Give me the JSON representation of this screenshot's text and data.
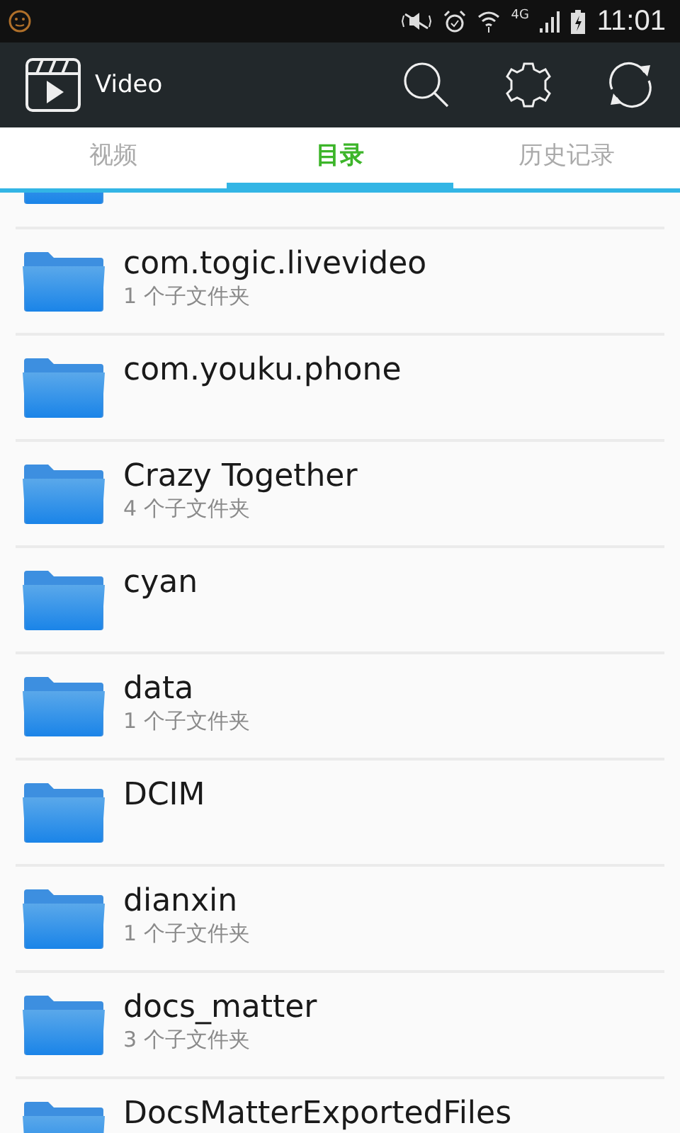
{
  "status_bar": {
    "network": "4G",
    "time": "11:01"
  },
  "app_bar": {
    "title": "Video"
  },
  "tabs": [
    {
      "label": "视频",
      "selected": false
    },
    {
      "label": "目录",
      "selected": true
    },
    {
      "label": "历史记录",
      "selected": false
    }
  ],
  "folders": [
    {
      "name": "com.togic.livevideo",
      "subtitle": "1 个子文件夹"
    },
    {
      "name": "com.youku.phone"
    },
    {
      "name": "Crazy Together",
      "subtitle": "4 个子文件夹"
    },
    {
      "name": "cyan"
    },
    {
      "name": "data",
      "subtitle": "1 个子文件夹"
    },
    {
      "name": "DCIM"
    },
    {
      "name": "dianxin",
      "subtitle": "1 个子文件夹"
    },
    {
      "name": "docs_matter",
      "subtitle": "3 个子文件夹"
    },
    {
      "name": "DocsMatterExportedFiles"
    }
  ]
}
